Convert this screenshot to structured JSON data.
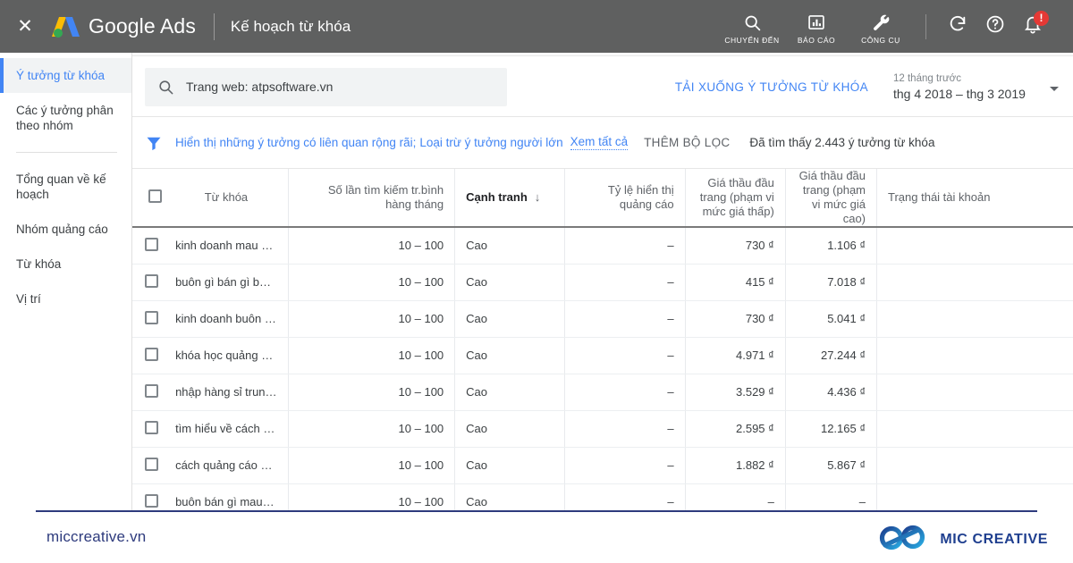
{
  "topbar": {
    "close_label": "✕",
    "brand": "Google Ads",
    "page_title": "Kế hoạch từ khóa",
    "tools": [
      {
        "label": "CHUYỂN ĐẾN",
        "icon": "search-icon"
      },
      {
        "label": "BÁO CÁO",
        "icon": "bar-chart-icon"
      },
      {
        "label": "CÔNG CỤ",
        "icon": "wrench-icon"
      }
    ],
    "refresh_icon": "refresh-icon",
    "help_icon": "help-icon",
    "notifications_icon": "bell-icon",
    "notifications_badge": "!"
  },
  "sidebar": {
    "items": [
      {
        "label": "Ý tưởng từ khóa",
        "active": true
      },
      {
        "label": "Các ý tưởng phân theo nhóm",
        "active": false
      },
      {
        "label": "Tổng quan về kế hoạch",
        "active": false
      },
      {
        "label": "Nhóm quảng cáo",
        "active": false
      },
      {
        "label": "Từ khóa",
        "active": false
      },
      {
        "label": "Vị trí",
        "active": false
      }
    ]
  },
  "search": {
    "icon": "search-icon",
    "value": "Trang web: atpsoftware.vn",
    "placeholder": "Trang web: atpsoftware.vn"
  },
  "toolbar": {
    "download_label": "TẢI XUỐNG Ý TƯỞNG TỪ KHÓA",
    "date_range_caption": "12 tháng trước",
    "date_range_value": "thg 4 2018 – thg 3 2019"
  },
  "filters": {
    "icon": "filter-funnel-icon",
    "chip_broad": "Hiển thị những ý tưởng có liên quan rộng rãi;",
    "chip_adult": "Loại trừ ý tưởng người lớn",
    "see_all": "Xem tất cả",
    "add_filter": "THÊM BỘ LỌC",
    "found_count": "Đã tìm thấy 2.443 ý tưởng từ khóa"
  },
  "table": {
    "headers": {
      "keyword": "Từ khóa",
      "volume": "Số lần tìm kiếm tr.bình hàng tháng",
      "competition": "Cạnh tranh",
      "competition_sort": "↓",
      "ad_impr_share": "Tỷ lệ hiển thị quảng cáo",
      "top_bid_low": "Giá thầu đầu trang (phạm vi mức giá thấp)",
      "top_bid_high": "Giá thầu đầu trang (phạm vi mức giá cao)",
      "account_status": "Trạng thái tài khoản"
    },
    "rows": [
      {
        "keyword": "kinh doanh mau gi...",
        "volume": "10 – 100",
        "competition": "Cao",
        "share": "–",
        "bid_low": "730 ₫",
        "bid_high": "1.106 ₫",
        "status": ""
      },
      {
        "keyword": "buôn gì bán gì bây ...",
        "volume": "10 – 100",
        "competition": "Cao",
        "share": "–",
        "bid_low": "415 ₫",
        "bid_high": "7.018 ₫",
        "status": ""
      },
      {
        "keyword": "kinh doanh buôn b...",
        "volume": "10 – 100",
        "competition": "Cao",
        "share": "–",
        "bid_low": "730 ₫",
        "bid_high": "5.041 ₫",
        "status": ""
      },
      {
        "keyword": "khóa học quảng cá...",
        "volume": "10 – 100",
        "competition": "Cao",
        "share": "–",
        "bid_low": "4.971 ₫",
        "bid_high": "27.244 ₫",
        "status": ""
      },
      {
        "keyword": "nhập hàng sỉ trung ...",
        "volume": "10 – 100",
        "competition": "Cao",
        "share": "–",
        "bid_low": "3.529 ₫",
        "bid_high": "4.436 ₫",
        "status": ""
      },
      {
        "keyword": "tìm hiểu về cách b...",
        "volume": "10 – 100",
        "competition": "Cao",
        "share": "–",
        "bid_low": "2.595 ₫",
        "bid_high": "12.165 ₫",
        "status": ""
      },
      {
        "keyword": "cách quảng cáo bá...",
        "volume": "10 – 100",
        "competition": "Cao",
        "share": "–",
        "bid_low": "1.882 ₫",
        "bid_high": "5.867 ₫",
        "status": ""
      },
      {
        "keyword": "buôn bán gì mau gi...",
        "volume": "10 – 100",
        "competition": "Cao",
        "share": "–",
        "bid_low": "–",
        "bid_high": "–",
        "status": ""
      }
    ]
  },
  "footer": {
    "url": "miccreative.vn",
    "brand": "MIC CREATIVE",
    "logo_icon": "mic-infinity-logo"
  },
  "colors": {
    "topbar_bg": "#5f6060",
    "accent_blue": "#4285f4",
    "footer_navy": "#2e3b7d",
    "badge_red": "#e53935"
  }
}
